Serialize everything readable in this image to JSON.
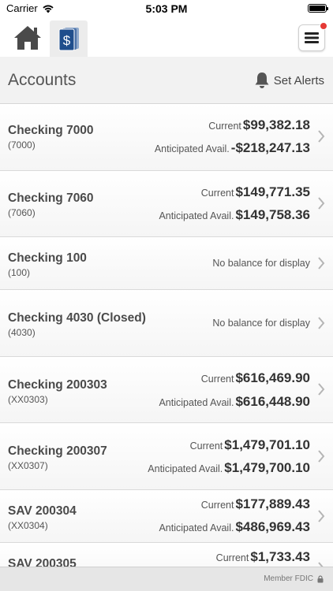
{
  "status_bar": {
    "carrier": "Carrier",
    "time": "5:03 PM"
  },
  "header": {
    "home_icon": "home-icon",
    "accounts_icon": "money-cards-icon",
    "menu_icon": "hamburger-menu-icon",
    "badge_color": "#e53935",
    "accent_color": "#1f4e8c"
  },
  "title_bar": {
    "title": "Accounts",
    "alerts_label": "Set Alerts"
  },
  "accounts": [
    {
      "name": "Checking 7000",
      "number": "(7000)",
      "current_label": "Current",
      "current": "$99,382.18",
      "anticipated_label": "Anticipated Avail.",
      "anticipated": "-$218,247.13"
    },
    {
      "name": "Checking 7060",
      "number": "(7060)",
      "current_label": "Current",
      "current": "$149,771.35",
      "anticipated_label": "Anticipated Avail.",
      "anticipated": "$149,758.36"
    },
    {
      "name": "Checking 100",
      "number": "(100)",
      "no_balance": "No balance for display"
    },
    {
      "name": "Checking 4030 (Closed)",
      "number": "(4030)",
      "no_balance": "No balance for display"
    },
    {
      "name": "Checking 200303",
      "number": "(XX0303)",
      "current_label": "Current",
      "current": "$616,469.90",
      "anticipated_label": "Anticipated Avail.",
      "anticipated": "$616,448.90"
    },
    {
      "name": "Checking 200307",
      "number": "(XX0307)",
      "current_label": "Current",
      "current": "$1,479,701.10",
      "anticipated_label": "Anticipated Avail.",
      "anticipated": "$1,479,700.10"
    },
    {
      "name": "SAV 200304",
      "number": "(XX0304)",
      "current_label": "Current",
      "current": "$177,889.43",
      "anticipated_label": "Anticipated Avail.",
      "anticipated": "$486,969.43"
    },
    {
      "name": "SAV 200305",
      "number": "",
      "current_label": "Current",
      "current": "$1,733.43"
    }
  ],
  "footer": {
    "text": "Member FDIC",
    "icon": "lock-icon"
  }
}
